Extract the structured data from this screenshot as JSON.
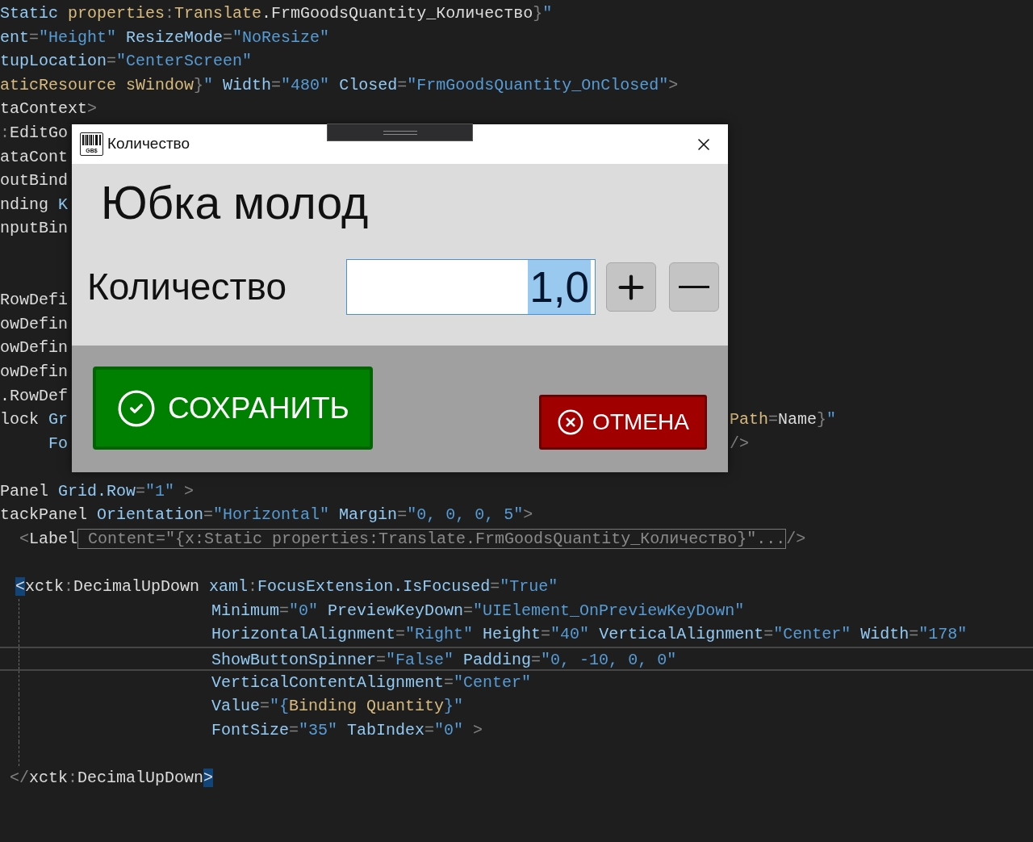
{
  "editor": {
    "lines": [
      {
        "current": false,
        "tokens": [
          {
            "kind": "attr",
            "text": "Static"
          },
          {
            "kind": "ext",
            "text": " properties"
          },
          {
            "kind": "punct",
            "text": ":"
          },
          {
            "kind": "ext",
            "text": "Translate"
          },
          {
            "kind": "plain",
            "text": ".FrmGoodsQuantity_Количество"
          },
          {
            "kind": "punct",
            "text": "}"
          },
          {
            "kind": "value",
            "text": "\""
          }
        ]
      },
      {
        "current": false,
        "tokens": [
          {
            "kind": "attr",
            "text": "ent"
          },
          {
            "kind": "punct",
            "text": "="
          },
          {
            "kind": "value",
            "text": "\"Height\""
          },
          {
            "kind": "attr",
            "text": " ResizeMode"
          },
          {
            "kind": "punct",
            "text": "="
          },
          {
            "kind": "value",
            "text": "\"NoResize\""
          }
        ]
      },
      {
        "current": false,
        "tokens": [
          {
            "kind": "attr",
            "text": "tupLocation"
          },
          {
            "kind": "punct",
            "text": "="
          },
          {
            "kind": "value",
            "text": "\"CenterScreen\""
          }
        ]
      },
      {
        "current": false,
        "tokens": [
          {
            "kind": "ext",
            "text": "aticResource sWindow"
          },
          {
            "kind": "punct",
            "text": "}"
          },
          {
            "kind": "value",
            "text": "\""
          },
          {
            "kind": "attr",
            "text": " Width"
          },
          {
            "kind": "punct",
            "text": "="
          },
          {
            "kind": "value",
            "text": "\"480\""
          },
          {
            "kind": "attr",
            "text": " Closed"
          },
          {
            "kind": "punct",
            "text": "="
          },
          {
            "kind": "value",
            "text": "\"FrmGoodsQuantity_OnClosed\""
          },
          {
            "kind": "punct",
            "text": ">"
          }
        ]
      },
      {
        "current": false,
        "tokens": [
          {
            "kind": "plain",
            "text": "taContext"
          },
          {
            "kind": "punct",
            "text": ">"
          }
        ]
      },
      {
        "current": false,
        "tokens": [
          {
            "kind": "punct",
            "text": ":"
          },
          {
            "kind": "plain",
            "text": "EditGo"
          }
        ]
      },
      {
        "current": false,
        "tokens": [
          {
            "kind": "plain",
            "text": "ataCont"
          }
        ]
      },
      {
        "current": false,
        "tokens": [
          {
            "kind": "plain",
            "text": "outBind"
          }
        ]
      },
      {
        "current": false,
        "tokens": [
          {
            "kind": "plain",
            "text": "nding"
          },
          {
            "kind": "attr",
            "text": " K"
          }
        ]
      },
      {
        "current": false,
        "tokens": [
          {
            "kind": "plain",
            "text": "nputBin"
          }
        ]
      },
      {
        "current": false
      },
      {
        "current": false
      },
      {
        "current": false,
        "tokens": [
          {
            "kind": "plain",
            "text": "RowDefi"
          }
        ]
      },
      {
        "current": false,
        "tokens": [
          {
            "kind": "plain",
            "text": "owDefin"
          }
        ]
      },
      {
        "current": false,
        "tokens": [
          {
            "kind": "plain",
            "text": "owDefin"
          }
        ]
      },
      {
        "current": false,
        "tokens": [
          {
            "kind": "plain",
            "text": "owDefin"
          }
        ]
      },
      {
        "current": false,
        "tokens": [
          {
            "kind": "plain",
            "text": ".RowDef"
          }
        ]
      },
      {
        "current": false,
        "tokens": [
          {
            "kind": "plain",
            "text": "lock"
          },
          {
            "kind": "attr",
            "text": " Gr"
          }
        ],
        "right": [
          {
            "kind": "ext",
            "text": "Path"
          },
          {
            "kind": "punct",
            "text": "="
          },
          {
            "kind": "plain",
            "text": "Name"
          },
          {
            "kind": "punct",
            "text": "}"
          },
          {
            "kind": "value",
            "text": "\""
          }
        ]
      },
      {
        "current": false,
        "tokens": [
          {
            "kind": "attr",
            "text": "     Fo"
          }
        ],
        "right": [
          {
            "kind": "punct",
            "text": "/>"
          }
        ]
      },
      {
        "current": false
      },
      {
        "current": false,
        "tokens": [
          {
            "kind": "plain",
            "text": "Panel"
          },
          {
            "kind": "attr",
            "text": " Grid.Row"
          },
          {
            "kind": "punct",
            "text": "="
          },
          {
            "kind": "value",
            "text": "\"1\""
          },
          {
            "kind": "punct",
            "text": " >"
          }
        ]
      },
      {
        "current": false,
        "tokens": [
          {
            "kind": "plain",
            "text": "tackPanel"
          },
          {
            "kind": "attr",
            "text": " Orientation"
          },
          {
            "kind": "punct",
            "text": "="
          },
          {
            "kind": "value",
            "text": "\"Horizontal\""
          },
          {
            "kind": "attr",
            "text": " Margin"
          },
          {
            "kind": "punct",
            "text": "="
          },
          {
            "kind": "value",
            "text": "\"0, 0, 0, 5\""
          },
          {
            "kind": "punct",
            "text": ">"
          }
        ]
      },
      {
        "current": false,
        "tokens": [
          {
            "kind": "punct",
            "text": "  <"
          },
          {
            "kind": "plain",
            "text": "Label"
          },
          {
            "kind": "collapsed",
            "text": " Content=\"{x:Static properties:Translate.FrmGoodsQuantity_Количество}\"..."
          },
          {
            "kind": "punct",
            "text": "/>"
          }
        ]
      },
      {
        "current": false
      },
      {
        "current": false,
        "tokens": [
          {
            "kind": "match",
            "text": "<"
          },
          {
            "kind": "plain",
            "text": "xctk"
          },
          {
            "kind": "punct",
            "text": ":"
          },
          {
            "kind": "plain",
            "text": "DecimalUpDown"
          },
          {
            "kind": "attr",
            "text": " xaml"
          },
          {
            "kind": "punct",
            "text": ":"
          },
          {
            "kind": "attr",
            "text": "FocusExtension.IsFocused"
          },
          {
            "kind": "punct",
            "text": "="
          },
          {
            "kind": "value",
            "text": "\"True\""
          }
        ]
      },
      {
        "current": false,
        "guide": true,
        "tokens": [
          {
            "kind": "attr",
            "text": "Minimum"
          },
          {
            "kind": "punct",
            "text": "="
          },
          {
            "kind": "value",
            "text": "\"0\""
          },
          {
            "kind": "attr",
            "text": " PreviewKeyDown"
          },
          {
            "kind": "punct",
            "text": "="
          },
          {
            "kind": "value",
            "text": "\"UIElement_OnPreviewKeyDown\""
          }
        ]
      },
      {
        "current": false,
        "guide": true,
        "tokens": [
          {
            "kind": "attr",
            "text": "HorizontalAlignment"
          },
          {
            "kind": "punct",
            "text": "="
          },
          {
            "kind": "value",
            "text": "\"Right\""
          },
          {
            "kind": "attr",
            "text": " Height"
          },
          {
            "kind": "punct",
            "text": "="
          },
          {
            "kind": "value",
            "text": "\"40\""
          },
          {
            "kind": "attr",
            "text": " VerticalAlignment"
          },
          {
            "kind": "punct",
            "text": "="
          },
          {
            "kind": "value",
            "text": "\"Center\""
          },
          {
            "kind": "attr",
            "text": " Width"
          },
          {
            "kind": "punct",
            "text": "="
          },
          {
            "kind": "value",
            "text": "\"178\""
          }
        ]
      },
      {
        "current": true,
        "guide": true,
        "tokens": [
          {
            "kind": "attr",
            "text": "ShowButtonSpinner"
          },
          {
            "kind": "punct",
            "text": "="
          },
          {
            "kind": "value",
            "text": "\"False\""
          },
          {
            "kind": "attr",
            "text": " Padding"
          },
          {
            "kind": "punct",
            "text": "="
          },
          {
            "kind": "value",
            "text": "\"0, -10, 0, 0\""
          }
        ]
      },
      {
        "current": false,
        "guide": true,
        "tokens": [
          {
            "kind": "attr",
            "text": "VerticalContentAlignment"
          },
          {
            "kind": "punct",
            "text": "="
          },
          {
            "kind": "value",
            "text": "\"Center\""
          }
        ]
      },
      {
        "current": false,
        "guide": true,
        "tokens": [
          {
            "kind": "attr",
            "text": "Value"
          },
          {
            "kind": "punct",
            "text": "="
          },
          {
            "kind": "value",
            "text": "\"{"
          },
          {
            "kind": "ext",
            "text": "Binding Quantity"
          },
          {
            "kind": "value",
            "text": "}\""
          }
        ]
      },
      {
        "current": false,
        "guide": true,
        "tokens": [
          {
            "kind": "attr",
            "text": "FontSize"
          },
          {
            "kind": "punct",
            "text": "="
          },
          {
            "kind": "value",
            "text": "\"35\""
          },
          {
            "kind": "attr",
            "text": " TabIndex"
          },
          {
            "kind": "punct",
            "text": "="
          },
          {
            "kind": "value",
            "text": "\"0\""
          },
          {
            "kind": "punct",
            "text": " >"
          }
        ]
      },
      {
        "guide": true
      },
      {
        "current": false,
        "tokens": [
          {
            "kind": "punct",
            "text": " </"
          },
          {
            "kind": "plain",
            "text": "xctk"
          },
          {
            "kind": "punct",
            "text": ":"
          },
          {
            "kind": "plain",
            "text": "DecimalUpDown"
          },
          {
            "kind": "match",
            "text": ">"
          }
        ]
      }
    ]
  },
  "dialog": {
    "logo_text": "GB$",
    "title": "Количество",
    "product_name": "Юбка молод",
    "quantity_label": "Количество",
    "quantity_value": "1,0",
    "value_selected": true,
    "steppers": [
      {
        "kind": "increment"
      },
      {
        "kind": "decrement"
      }
    ],
    "buttons": [
      {
        "kind": "save",
        "label": "СОХРАНИТЬ"
      },
      {
        "kind": "cancel",
        "label": "ОТМЕНА"
      }
    ]
  }
}
